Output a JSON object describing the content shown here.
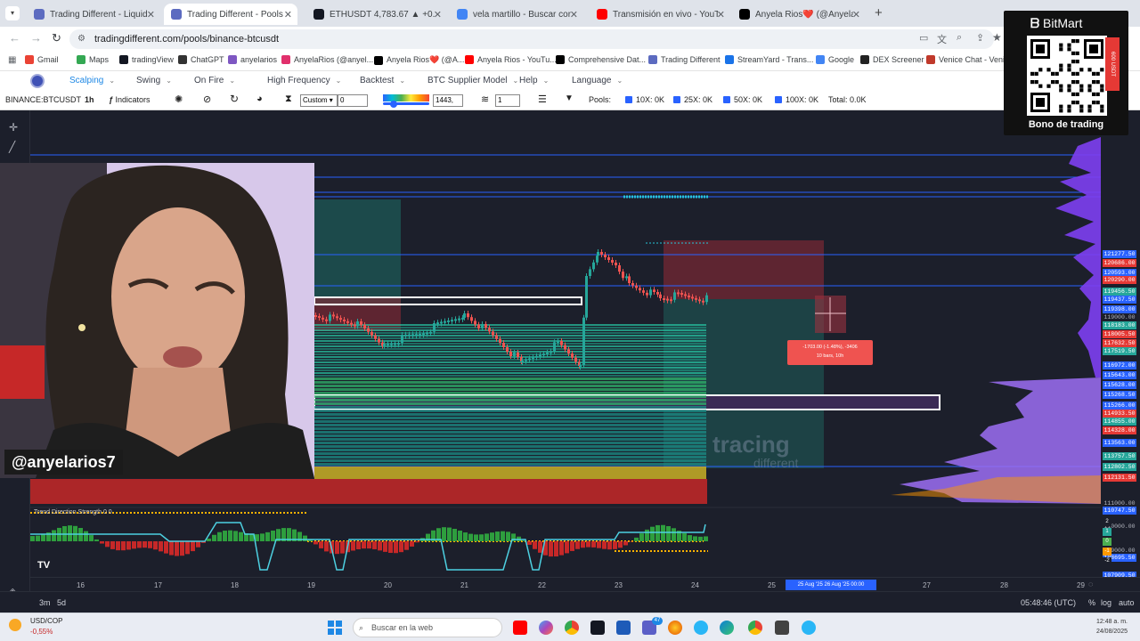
{
  "browser": {
    "tabs": [
      {
        "title": "Trading Different - Liquidation",
        "icon": "globe-icon",
        "color": "#5c6bc0"
      },
      {
        "title": "Trading Different - Pools de Liq",
        "icon": "globe-icon",
        "color": "#5c6bc0"
      },
      {
        "title": "ETHUSDT 4,783.67 ▲ +0.11% b",
        "icon": "tradingview-icon",
        "color": "#131722"
      },
      {
        "title": "vela martillo - Buscar con Goog",
        "icon": "google-icon",
        "color": "#4285f4"
      },
      {
        "title": "Transmisión en vivo - YouTube",
        "icon": "youtube-icon",
        "color": "#ff0000"
      },
      {
        "title": "Anyela Rios❤️ (@AnyelaRios7)",
        "icon": "x-icon",
        "color": "#000000"
      }
    ],
    "url": "tradingdifferent.com/pools/binance-btcusdt",
    "bookmarks": [
      {
        "label": "Gmail",
        "color": "#ea4335"
      },
      {
        "label": "Maps",
        "color": "#34a853"
      },
      {
        "label": "tradingView",
        "color": "#131722"
      },
      {
        "label": "ChatGPT",
        "color": "#333333"
      },
      {
        "label": "anyelarios",
        "color": "#7e57c2"
      },
      {
        "label": "AnyelaRios (@anyel...",
        "color": "#e1306c"
      },
      {
        "label": "Anyela Rios❤️ (@A...",
        "color": "#000000"
      },
      {
        "label": "Anyela Rios - YouTu...",
        "color": "#ff0000"
      },
      {
        "label": "Comprehensive Dat...",
        "color": "#000000"
      },
      {
        "label": "Trading Different",
        "color": "#5c6bc0"
      },
      {
        "label": "StreamYard - Trans...",
        "color": "#1a73e8"
      },
      {
        "label": "Google",
        "color": "#4285f4"
      },
      {
        "label": "DEX Screener",
        "color": "#222222"
      },
      {
        "label": "Venice Chat - Venic...",
        "color": "#c0392b"
      }
    ]
  },
  "site_nav": {
    "items": [
      "Scalping",
      "Swing",
      "On Fire",
      "High Frequency",
      "Backtest",
      "BTC Supplier Model",
      "Help",
      "Language"
    ]
  },
  "chart_toolbar": {
    "symbol": "BINANCE:BTCUSDT",
    "interval": "1h",
    "indicators": "Indicators",
    "custom_select": "Custom",
    "custom_value": "0",
    "slider_value": "1443,",
    "layers_value": "1",
    "pools_label": "Pools:",
    "pools": [
      "10X: 0K",
      "25X: 0K",
      "50X: 0K",
      "100X: 0K"
    ],
    "total": "Total: 0.0K"
  },
  "chart": {
    "price_labels": [
      {
        "v": "121277.50",
        "c": "#2962ff"
      },
      {
        "v": "120686.00",
        "c": "#e53935"
      },
      {
        "v": "120593.00",
        "c": "#2962ff"
      },
      {
        "v": "120290.00",
        "c": "#e53935"
      },
      {
        "v": "119456.50",
        "c": "#26a69a"
      },
      {
        "v": "119437.50",
        "c": "#2962ff"
      },
      {
        "v": "119398.00",
        "c": "#2962ff"
      },
      {
        "v": "119000.00",
        "c": "#1c1f2b"
      },
      {
        "v": "118183.00",
        "c": "#26a69a"
      },
      {
        "v": "118005.50",
        "c": "#e53935"
      },
      {
        "v": "117632.50",
        "c": "#e53935"
      },
      {
        "v": "117519.50",
        "c": "#26a69a"
      },
      {
        "v": "116972.00",
        "c": "#2962ff"
      },
      {
        "v": "115643.00",
        "c": "#2962ff"
      },
      {
        "v": "115628.00",
        "c": "#2962ff"
      },
      {
        "v": "115268.50",
        "c": "#2962ff"
      },
      {
        "v": "115266.00",
        "c": "#2962ff"
      },
      {
        "v": "114933.50",
        "c": "#e53935"
      },
      {
        "v": "114855.00",
        "c": "#26a69a"
      },
      {
        "v": "114328.00",
        "c": "#e53935"
      },
      {
        "v": "113563.00",
        "c": "#2962ff"
      },
      {
        "v": "113757.50",
        "c": "#26a69a"
      },
      {
        "v": "112802.50",
        "c": "#26a69a"
      },
      {
        "v": "112131.50",
        "c": "#e53935"
      },
      {
        "v": "111000.00",
        "c": "#1c1f2b"
      },
      {
        "v": "110747.50",
        "c": "#2962ff"
      },
      {
        "v": "110000.00",
        "c": "#1c1f2b"
      },
      {
        "v": "109000.00",
        "c": "#1c1f2b"
      },
      {
        "v": "108695.50",
        "c": "#2962ff"
      },
      {
        "v": "107909.50",
        "c": "#2962ff"
      },
      {
        "v": "107847.00",
        "c": "#2962ff"
      },
      {
        "v": "107000.00",
        "c": "#1c1f2b"
      },
      {
        "v": "5,681K",
        "c": "#e53935"
      }
    ],
    "time_labels": [
      "16",
      "17",
      "18",
      "19",
      "20",
      "21",
      "22",
      "23",
      "24",
      "25",
      "27",
      "28",
      "29"
    ],
    "date_range_label": "25 Aug '25  26 Aug '25  00:00",
    "position_tooltip_line1": "-1703.00 (-1.48%), -3406",
    "position_tooltip_line2": "10 bars, 10h",
    "indicator_title": "Trend Direction Strength  0  0",
    "osc_labels": [
      "2",
      "1",
      "0",
      "-1",
      "-2"
    ],
    "watermark": "tracing",
    "watermark_sub": "different",
    "range_buttons": [
      "3m",
      "5d"
    ],
    "clock": "05:48:46 (UTC)",
    "scale_modes": [
      "%",
      "log",
      "auto"
    ]
  },
  "stream": {
    "handle": "@anyelarios7"
  },
  "sponsor": {
    "brand": "BitMart",
    "caption": "Bono de trading",
    "ribbon": "600 USDT"
  },
  "taskbar": {
    "ticker": "USD/COP",
    "ticker_change": "-0,55%",
    "search_placeholder": "Buscar en la web",
    "time": "12:48 a. m.",
    "date": "24/08/2025",
    "teams_badge": "47"
  }
}
